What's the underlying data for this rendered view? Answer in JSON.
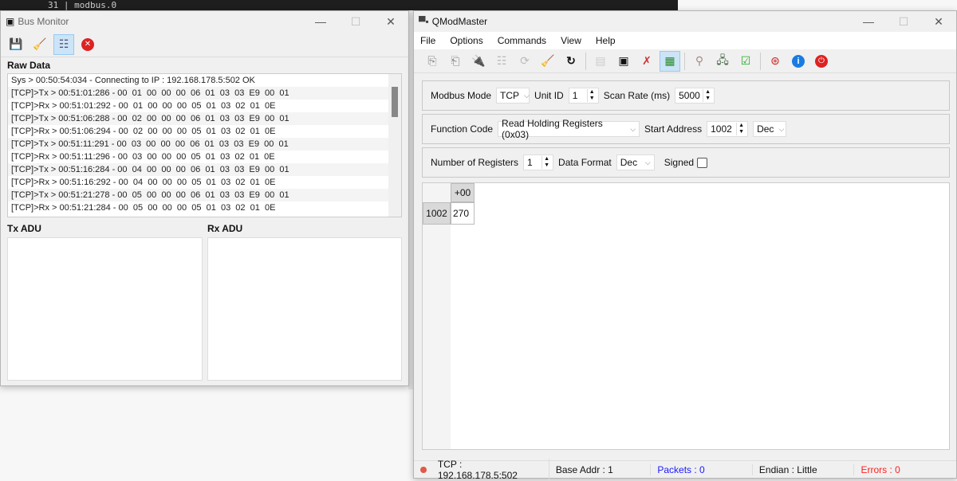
{
  "background": {
    "editor_text": "31 | modbus.0"
  },
  "bus_monitor": {
    "title": "Bus Monitor",
    "toolbar": [
      "save-icon",
      "clear-icon",
      "raw-data-icon",
      "close-icon"
    ],
    "raw_data_label": "Raw Data",
    "raw_rows": [
      "Sys > 00:50:54:034 - Connecting to IP : 192.168.178.5:502 OK",
      "[TCP]>Tx > 00:51:01:286 - 00  01  00  00  00  06  01  03  03  E9  00  01",
      "[TCP]>Rx > 00:51:01:292 - 00  01  00  00  00  05  01  03  02  01  0E",
      "[TCP]>Tx > 00:51:06:288 - 00  02  00  00  00  06  01  03  03  E9  00  01",
      "[TCP]>Rx > 00:51:06:294 - 00  02  00  00  00  05  01  03  02  01  0E",
      "[TCP]>Tx > 00:51:11:291 - 00  03  00  00  00  06  01  03  03  E9  00  01",
      "[TCP]>Rx > 00:51:11:296 - 00  03  00  00  00  05  01  03  02  01  0E",
      "[TCP]>Tx > 00:51:16:284 - 00  04  00  00  00  06  01  03  03  E9  00  01",
      "[TCP]>Rx > 00:51:16:292 - 00  04  00  00  00  05  01  03  02  01  0E",
      "[TCP]>Tx > 00:51:21:278 - 00  05  00  00  00  06  01  03  03  E9  00  01",
      "[TCP]>Rx > 00:51:21:284 - 00  05  00  00  00  05  01  03  02  01  0E"
    ],
    "tx_adu_label": "Tx ADU",
    "rx_adu_label": "Rx ADU"
  },
  "qmodmaster": {
    "title": "QModMaster",
    "menu": [
      "File",
      "Options",
      "Commands",
      "View",
      "Help"
    ],
    "modbus_mode_label": "Modbus Mode",
    "modbus_mode": "TCP",
    "unit_id_label": "Unit ID",
    "unit_id": "1",
    "scan_rate_label": "Scan Rate (ms)",
    "scan_rate": "5000",
    "function_code_label": "Function Code",
    "function_code": "Read Holding Registers (0x03)",
    "start_address_label": "Start Address",
    "start_address": "1002",
    "address_format": "Dec",
    "num_registers_label": "Number of Registers",
    "num_registers": "1",
    "data_format_label": "Data Format",
    "data_format": "Dec",
    "signed_label": "Signed",
    "signed": false,
    "table": {
      "col_header": "+00",
      "row_header": "1002",
      "value": "270"
    },
    "status": {
      "connection": "TCP : 192.168.178.5:502",
      "base_addr": "Base Addr : 1",
      "packets": "Packets : 0",
      "endian": "Endian : Little",
      "errors": "Errors : 0"
    },
    "colors": {
      "packets": "#1a1aff",
      "errors": "#ff2020"
    }
  }
}
